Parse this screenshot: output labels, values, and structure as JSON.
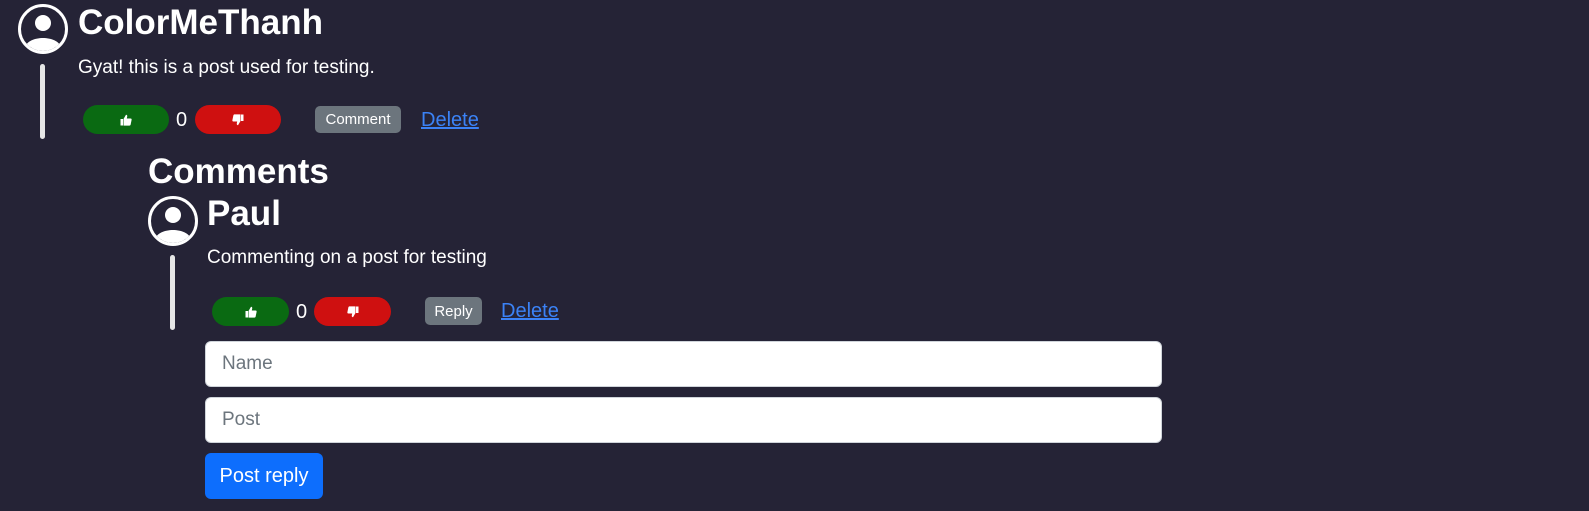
{
  "post": {
    "author": "ColorMeThanh",
    "text": "Gyat! this is a post used for testing.",
    "votes": "0",
    "comment_label": "Comment",
    "delete_label": "Delete"
  },
  "comments_section": {
    "title": "Comments"
  },
  "comment": {
    "author": "Paul",
    "text": "Commenting on a post for testing",
    "votes": "0",
    "reply_label": "Reply",
    "delete_label": "Delete"
  },
  "reply_form": {
    "name_placeholder": "Name",
    "post_placeholder": "Post",
    "submit_label": "Post reply"
  },
  "colors": {
    "background": "#252336",
    "upvote": "#0a6a12",
    "downvote": "#cf1010",
    "link": "#3b82f6",
    "primary": "#0d6efd",
    "secondary": "#6c757d"
  },
  "icons": {
    "avatar": "user-avatar-icon",
    "upvote": "thumbs-up-icon",
    "downvote": "thumbs-down-icon"
  }
}
